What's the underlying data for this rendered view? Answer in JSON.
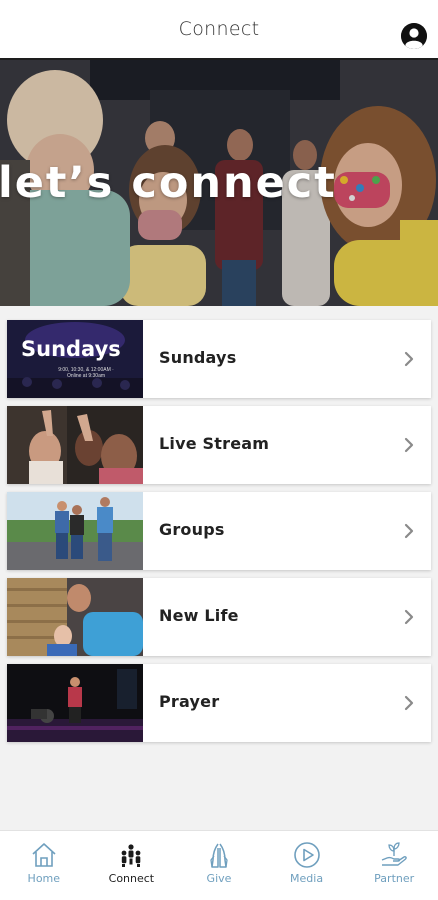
{
  "header": {
    "title": "Connect",
    "profile_icon": "account-circle-icon"
  },
  "hero": {
    "title": "let’s connect"
  },
  "items": [
    {
      "label": "Sundays",
      "thumb_title": "Sundays",
      "thumb_sub": "9:00, 10:30, & 12:00AM · Online at 9:30am",
      "icon": "chevron-right-icon"
    },
    {
      "label": "Live Stream",
      "icon": "chevron-right-icon"
    },
    {
      "label": "Groups",
      "icon": "chevron-right-icon"
    },
    {
      "label": "New Life",
      "icon": "chevron-right-icon"
    },
    {
      "label": "Prayer",
      "icon": "chevron-right-icon"
    }
  ],
  "bottom_nav": {
    "items": [
      {
        "label": "Home",
        "icon": "home-icon",
        "active": false
      },
      {
        "label": "Connect",
        "icon": "people-icon",
        "active": true
      },
      {
        "label": "Give",
        "icon": "praying-hands-icon",
        "active": false
      },
      {
        "label": "Media",
        "icon": "play-circle-icon",
        "active": false
      },
      {
        "label": "Partner",
        "icon": "hand-plant-icon",
        "active": false
      }
    ]
  },
  "colors": {
    "accent": "#6f9fbe",
    "header_border": "#1d1d1d",
    "background": "#f2f2f2"
  }
}
